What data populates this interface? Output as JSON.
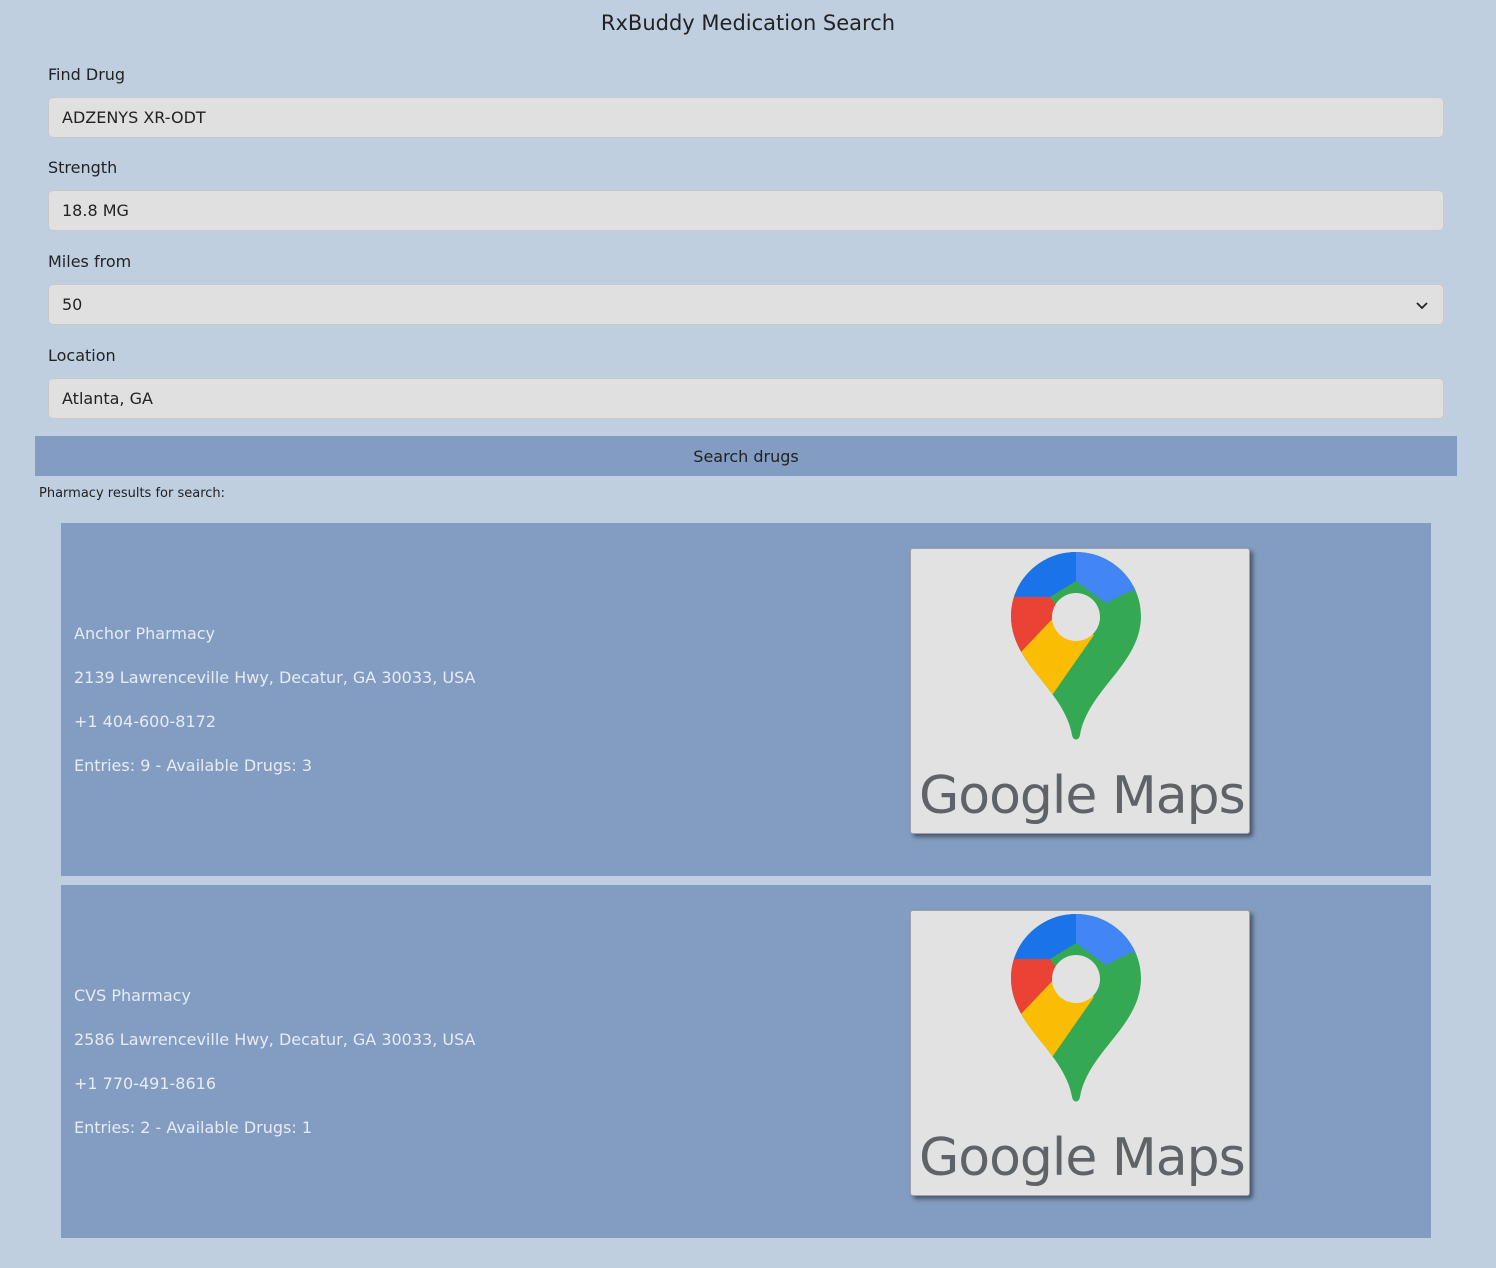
{
  "page": {
    "title": "RxBuddy Medication Search"
  },
  "form": {
    "drug": {
      "label": "Find Drug",
      "value": "ADZENYS XR-ODT"
    },
    "strength": {
      "label": "Strength",
      "value": "18.8 MG"
    },
    "miles": {
      "label": "Miles from",
      "value": "50"
    },
    "location": {
      "label": "Location",
      "value": "Atlanta, GA"
    },
    "search_label": "Search drugs"
  },
  "results": {
    "heading": "Pharmacy results for search:",
    "items": [
      {
        "name": "Anchor Pharmacy",
        "address": "2139 Lawrenceville Hwy, Decatur, GA 30033, USA",
        "phone": "+1 404-600-8172",
        "summary": "Entries: 9 - Available Drugs: 3",
        "map_logo_text": "Google Maps"
      },
      {
        "name": "CVS Pharmacy",
        "address": "2586 Lawrenceville Hwy, Decatur, GA 30033, USA",
        "phone": "+1 770-491-8616",
        "summary": "Entries: 2 - Available Drugs: 1",
        "map_logo_text": "Google Maps"
      }
    ]
  },
  "icons": {
    "maps_logo": "google-maps-pin-icon",
    "dropdown": "chevron-down-icon"
  },
  "colors": {
    "background": "#bfcfe0",
    "accent": "#839cc1",
    "field": "#e0e0e0",
    "card_text": "#e6ecf4"
  }
}
